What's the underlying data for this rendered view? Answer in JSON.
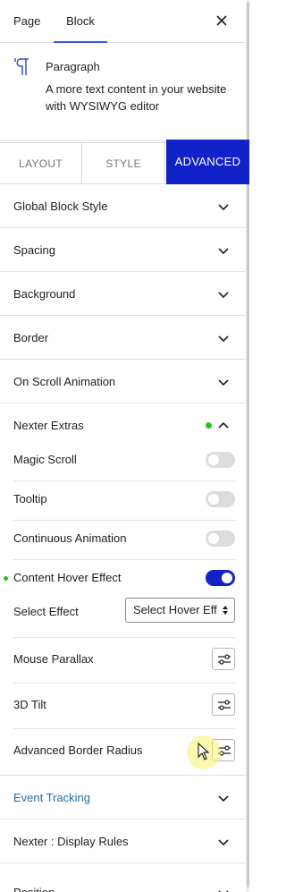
{
  "header": {
    "tabs": [
      {
        "label": "Page",
        "active": false
      },
      {
        "label": "Block",
        "active": true
      }
    ]
  },
  "block": {
    "icon": "paragraph-icon",
    "title": "Paragraph",
    "description": "A more text content in your website with WYSIWYG editor"
  },
  "style_tabs": {
    "layout": "LAYOUT",
    "style": "STYLE",
    "advanced": "ADVANCED",
    "active": "ADVANCED"
  },
  "panels": {
    "global_block_style": "Global Block Style",
    "spacing": "Spacing",
    "background": "Background",
    "border": "Border",
    "on_scroll_animation": "On Scroll Animation",
    "nexter_extras": "Nexter Extras",
    "event_tracking": "Event Tracking",
    "display_rules": "Nexter : Display Rules",
    "position": "Position"
  },
  "extras": {
    "magic_scroll": {
      "label": "Magic Scroll",
      "enabled": false
    },
    "tooltip": {
      "label": "Tooltip",
      "enabled": false
    },
    "continuous_animation": {
      "label": "Continuous Animation",
      "enabled": false
    },
    "content_hover_effect": {
      "label": "Content Hover Effect",
      "enabled": true
    },
    "select_effect": {
      "label": "Select Effect",
      "value": "Select Hover Eff"
    },
    "mouse_parallax": {
      "label": "Mouse Parallax"
    },
    "tilt_3d": {
      "label": "3D Tilt"
    },
    "advanced_border_radius": {
      "label": "Advanced Border Radius"
    }
  },
  "colors": {
    "accent": "#1321c8",
    "active_indicator": "#2ac02a",
    "link": "#1e6fa8"
  }
}
